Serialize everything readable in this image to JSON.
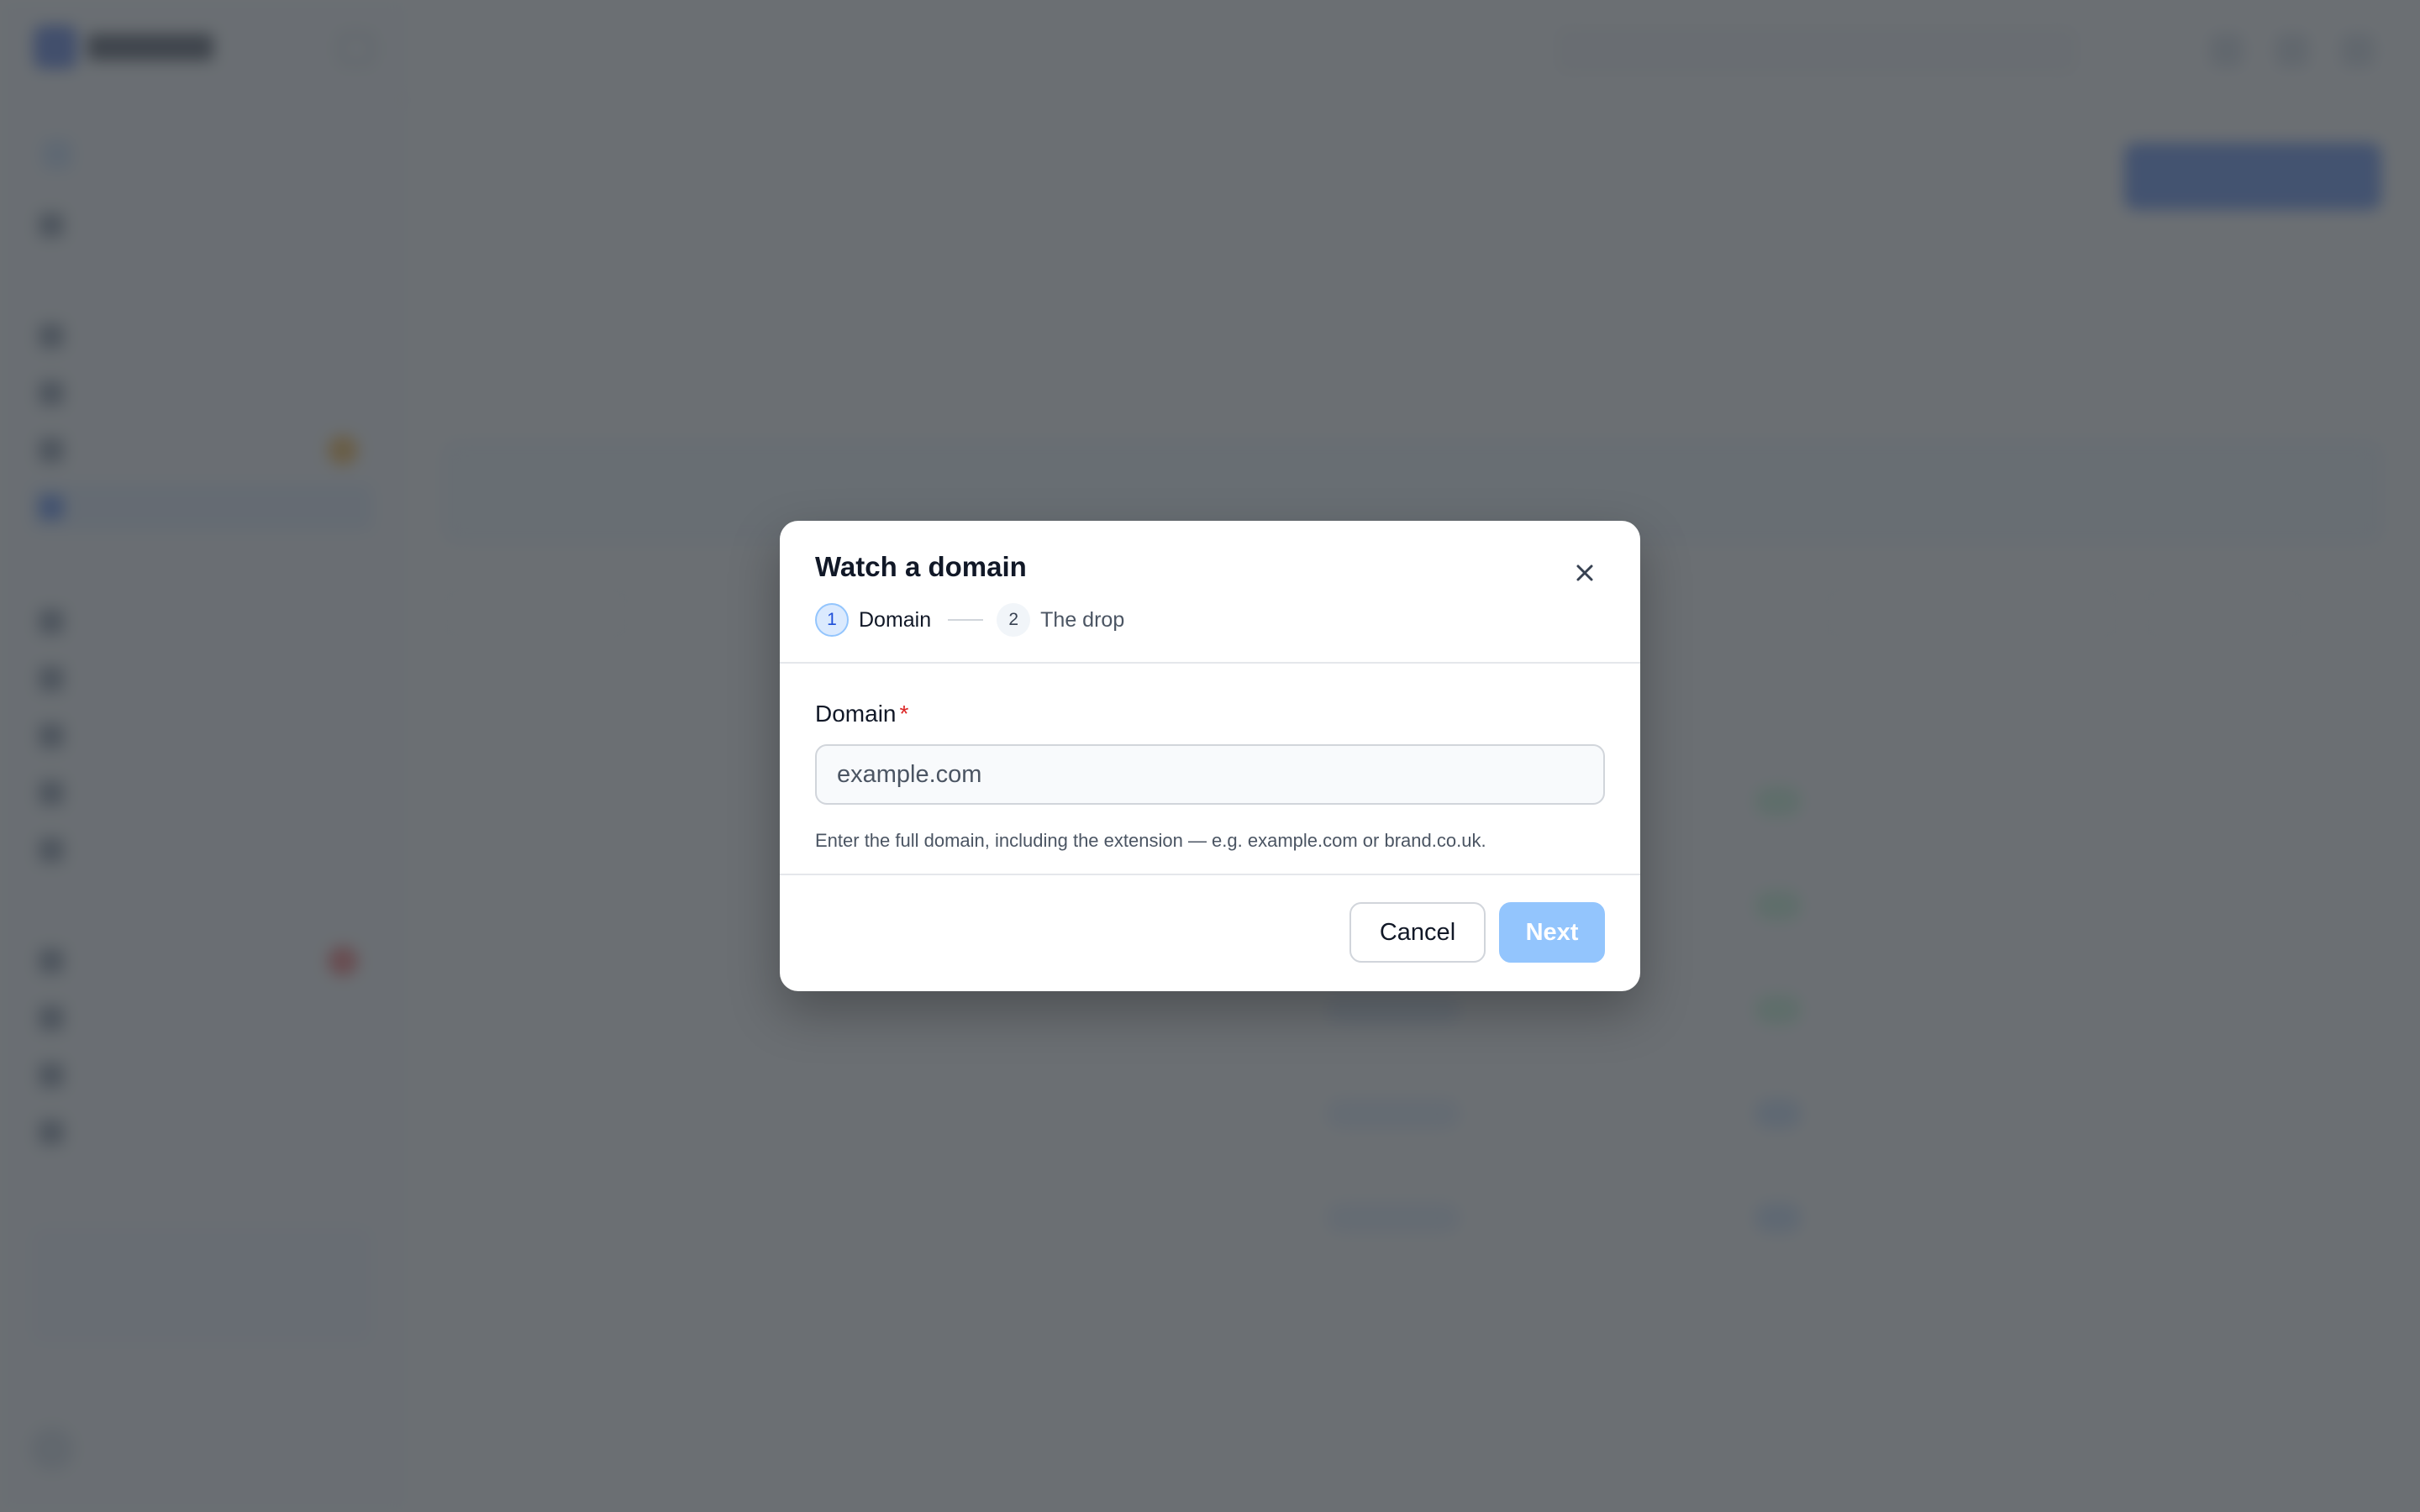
{
  "modal": {
    "title": "Watch a domain",
    "steps": [
      {
        "number": "1",
        "label": "Domain",
        "state": "active"
      },
      {
        "number": "2",
        "label": "The drop",
        "state": "inactive"
      }
    ],
    "field": {
      "label": "Domain",
      "required_marker": "*",
      "value": "",
      "placeholder": "example.com",
      "help": "Enter the full domain, including the extension — e.g. example.com or brand.co.uk."
    },
    "buttons": {
      "cancel": "Cancel",
      "next": "Next",
      "next_disabled": true,
      "close_icon": "close-icon"
    }
  },
  "colors": {
    "accent": "#2563eb",
    "accent_light": "#dbeafe",
    "next_disabled_bg": "#93c5fd",
    "required": "#dc2626",
    "overlay": "#4b4f54"
  }
}
